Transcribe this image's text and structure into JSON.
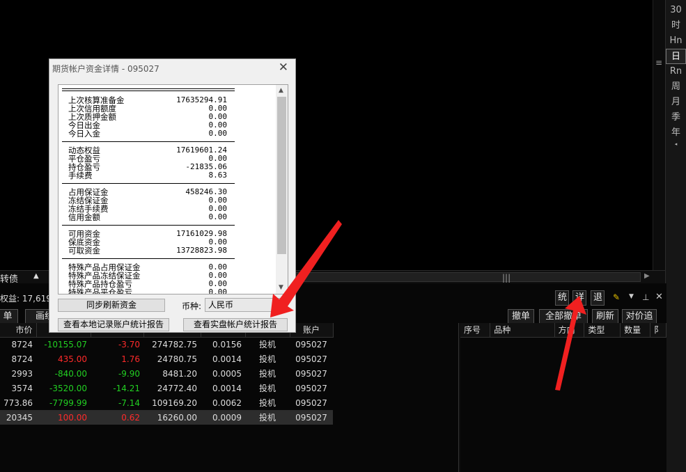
{
  "period_bar": {
    "items": [
      "30",
      "时",
      "Hn",
      "日",
      "Rn",
      "周",
      "月",
      "季",
      "年"
    ],
    "selected": "日"
  },
  "hscroll": {
    "left_label": "转债"
  },
  "summary": {
    "text": "权益: 17,619"
  },
  "controls": {
    "tong": "统",
    "xiang": "详",
    "tui": "退",
    "wrench_icon": "wrench-icon",
    "pin_icon": "pin-icon",
    "close_icon": "close-icon"
  },
  "left_buttons": {
    "b1": "单",
    "b2": "画线"
  },
  "right_buttons": {
    "cancel": "撤单",
    "cancel_all": "全部撤单",
    "refresh": "刷新",
    "chase": "对价追"
  },
  "positions": {
    "headers": {
      "price": "市价",
      "mid": "账户"
    },
    "rows": [
      {
        "price": "8724",
        "pl": "-10155.07",
        "pct": "-3.70",
        "margin": "274782.75",
        "ratio": "0.0156",
        "type": "投机",
        "account": "095027",
        "pl_color": "green",
        "pct_color": "red"
      },
      {
        "price": "8724",
        "pl": "435.00",
        "pct": "1.76",
        "margin": "24780.75",
        "ratio": "0.0014",
        "type": "投机",
        "account": "095027",
        "pl_color": "red",
        "pct_color": "red"
      },
      {
        "price": "2993",
        "pl": "-840.00",
        "pct": "-9.90",
        "margin": "8481.20",
        "ratio": "0.0005",
        "type": "投机",
        "account": "095027",
        "pl_color": "green",
        "pct_color": "green"
      },
      {
        "price": "3574",
        "pl": "-3520.00",
        "pct": "-14.21",
        "margin": "24772.40",
        "ratio": "0.0014",
        "type": "投机",
        "account": "095027",
        "pl_color": "green",
        "pct_color": "green"
      },
      {
        "price": "773.86",
        "pl": "-7799.99",
        "pct": "-7.14",
        "margin": "109169.20",
        "ratio": "0.0062",
        "type": "投机",
        "account": "095027",
        "pl_color": "green",
        "pct_color": "green"
      },
      {
        "price": "20345",
        "pl": "100.00",
        "pct": "0.62",
        "margin": "16260.00",
        "ratio": "0.0009",
        "type": "投机",
        "account": "095027",
        "pl_color": "red",
        "pct_color": "red"
      }
    ]
  },
  "orders": {
    "headers": [
      "序号",
      "品种",
      "方向",
      "类型",
      "数量",
      "阝"
    ]
  },
  "dialog": {
    "title": "期货帐户资金详情  -  095027",
    "sections": [
      [
        [
          "上次核算准备金",
          "17635294.91"
        ],
        [
          "上次信用额度",
          "0.00"
        ],
        [
          "上次质押金额",
          "0.00"
        ],
        [
          "今日出金",
          "0.00"
        ],
        [
          "今日入金",
          "0.00"
        ]
      ],
      [
        [
          "动态权益",
          "17619601.24"
        ],
        [
          "平仓盈亏",
          "0.00"
        ],
        [
          "持仓盈亏",
          "-21835.06"
        ],
        [
          "手续费",
          "8.63"
        ]
      ],
      [
        [
          "占用保证金",
          "458246.30"
        ],
        [
          "冻结保证金",
          "0.00"
        ],
        [
          "冻结手续费",
          "0.00"
        ],
        [
          "信用金额",
          "0.00"
        ]
      ],
      [
        [
          "可用资金",
          "17161029.98"
        ],
        [
          "保底资金",
          "0.00"
        ],
        [
          "可取资金",
          "13728823.98"
        ]
      ],
      [
        [
          "特殊产品占用保证金",
          "0.00"
        ],
        [
          "特殊产品冻结保证金",
          "0.00"
        ],
        [
          "特殊产品持仓盈亏",
          "0.00"
        ],
        [
          "特殊产品平仓盈亏",
          "0.00"
        ]
      ]
    ],
    "sync_button": "同步刷新资金",
    "currency_label": "币种:",
    "currency_value": "人民币",
    "local_report_button": "查看本地记录账户统计报告",
    "real_report_button": "查看实盘帐户统计报告"
  }
}
